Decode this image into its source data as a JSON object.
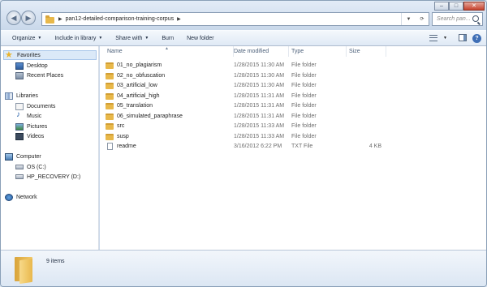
{
  "address": {
    "path": "pan12-detailed-comparison-training-corpus",
    "search_placeholder": "Search pan..."
  },
  "window_controls": {
    "minimize": "–",
    "maximize": "□",
    "close": "✕"
  },
  "toolbar": {
    "organize": "Organize",
    "include_in_library": "Include in library",
    "share_with": "Share with",
    "burn": "Burn",
    "new_folder": "New folder",
    "help": "?"
  },
  "nav": {
    "favorites": "Favorites",
    "desktop": "Desktop",
    "recent_places": "Recent Places",
    "libraries": "Libraries",
    "documents": "Documents",
    "music": "Music",
    "pictures": "Pictures",
    "videos": "Videos",
    "computer": "Computer",
    "os_drive": "OS (C:)",
    "recovery_drive": "HP_RECOVERY (D:)",
    "network": "Network"
  },
  "columns": {
    "name": "Name",
    "date_modified": "Date modified",
    "type": "Type",
    "size": "Size"
  },
  "files": [
    {
      "name": "01_no_plagiarism",
      "date": "1/28/2015 11:30 AM",
      "type": "File folder",
      "size": "",
      "icon": "folder-icon"
    },
    {
      "name": "02_no_obfuscation",
      "date": "1/28/2015 11:30 AM",
      "type": "File folder",
      "size": "",
      "icon": "folder-icon"
    },
    {
      "name": "03_artificial_low",
      "date": "1/28/2015 11:30 AM",
      "type": "File folder",
      "size": "",
      "icon": "folder-icon"
    },
    {
      "name": "04_artificial_high",
      "date": "1/28/2015 11:31 AM",
      "type": "File folder",
      "size": "",
      "icon": "folder-icon"
    },
    {
      "name": "05_translation",
      "date": "1/28/2015 11:31 AM",
      "type": "File folder",
      "size": "",
      "icon": "folder-icon"
    },
    {
      "name": "06_simulated_paraphrase",
      "date": "1/28/2015 11:31 AM",
      "type": "File folder",
      "size": "",
      "icon": "folder-icon"
    },
    {
      "name": "src",
      "date": "1/28/2015 11:33 AM",
      "type": "File folder",
      "size": "",
      "icon": "folder-icon"
    },
    {
      "name": "susp",
      "date": "1/28/2015 11:33 AM",
      "type": "File folder",
      "size": "",
      "icon": "folder-icon"
    },
    {
      "name": "readme",
      "date": "3/16/2012 6:22 PM",
      "type": "TXT File",
      "size": "4 KB",
      "icon": "text-file-icon"
    }
  ],
  "status": {
    "item_count": "9 items"
  }
}
